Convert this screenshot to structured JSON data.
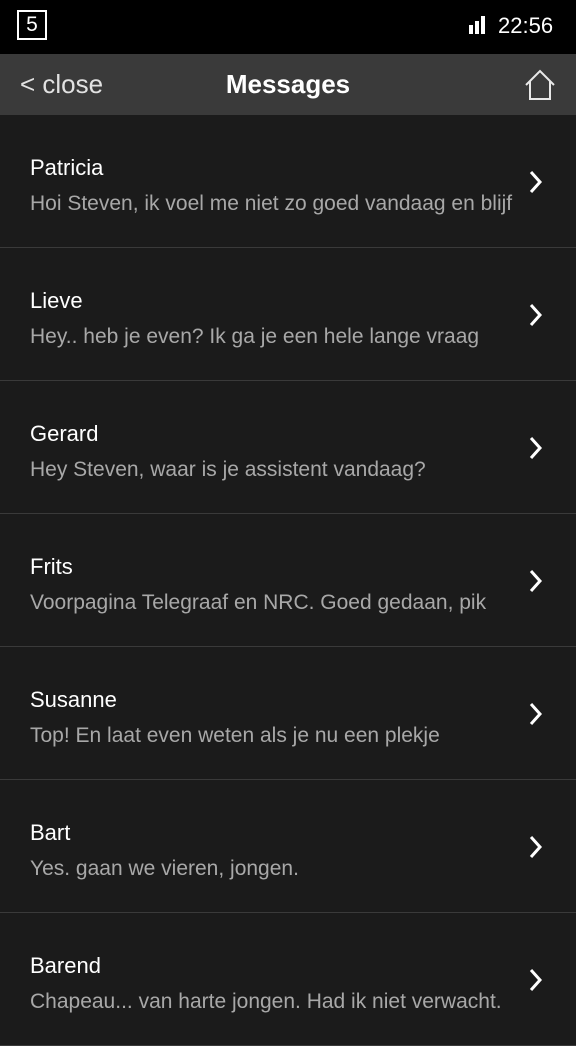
{
  "status_bar": {
    "notification_count": "5",
    "signal_icon": "signal-bars-icon",
    "time": "22:56"
  },
  "header": {
    "close_label": "< close",
    "title": "Messages",
    "home_icon": "home-icon"
  },
  "messages": [
    {
      "name": "Patricia",
      "preview": "Hoi Steven, ik voel me niet zo goed vandaag en blijf"
    },
    {
      "name": "Lieve",
      "preview": "Hey.. heb je even? Ik ga je een hele lange vraag"
    },
    {
      "name": "Gerard",
      "preview": "Hey Steven, waar is je assistent vandaag?"
    },
    {
      "name": "Frits",
      "preview": "Voorpagina Telegraaf en NRC. Goed gedaan, pik"
    },
    {
      "name": "Susanne",
      "preview": "Top! En laat even weten als je nu een plekje"
    },
    {
      "name": "Bart",
      "preview": "Yes. gaan we vieren, jongen."
    },
    {
      "name": "Barend",
      "preview": "Chapeau... van harte jongen. Had ik niet verwacht."
    }
  ],
  "colors": {
    "background": "#1b1b1b",
    "header_bar": "#3a3a3a",
    "status_bar": "#000000",
    "preview_text": "#a8a8a8",
    "divider": "#3a3a3a"
  }
}
